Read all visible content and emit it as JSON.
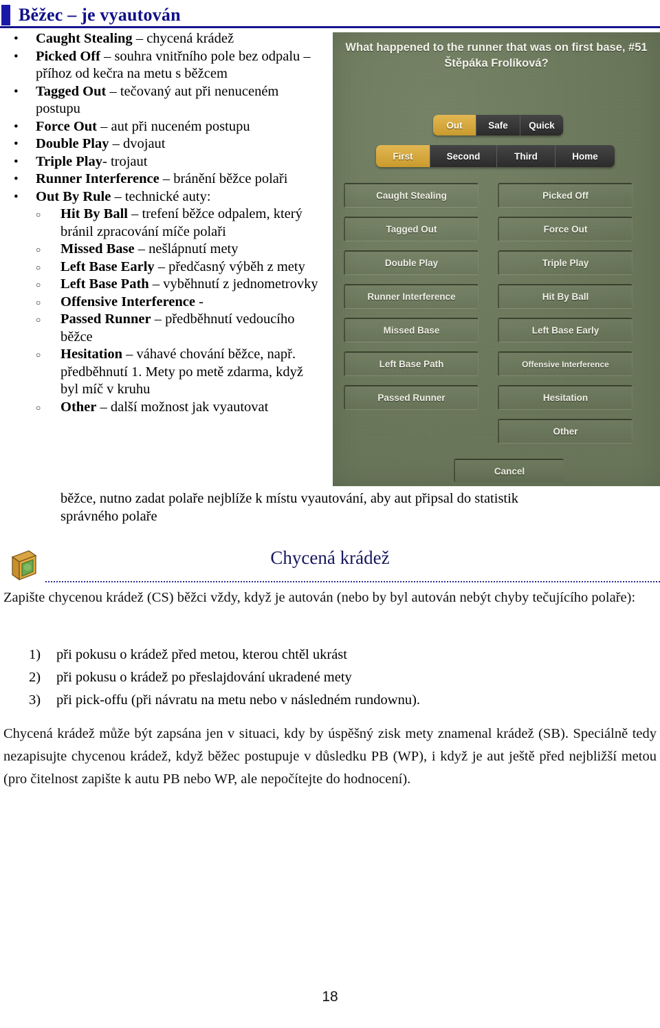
{
  "doc": {
    "title": "Běžec – je vyautován",
    "page_number": "18"
  },
  "bullets": [
    {
      "level": 1,
      "term": "Caught Stealing",
      "rest": " – chycená krádež"
    },
    {
      "level": 1,
      "term": "Picked Off",
      "rest": " – souhra vnitřního pole bez odpalu – příhoz od kečra na metu s běžcem"
    },
    {
      "level": 1,
      "term": "Tagged Out",
      "rest": " – tečovaný aut při nenuceném postupu"
    },
    {
      "level": 1,
      "term": "Force Out",
      "rest": " – aut při nuceném postupu"
    },
    {
      "level": 1,
      "term": "Double Play",
      "rest": " – dvojaut"
    },
    {
      "level": 1,
      "term": "Triple Play",
      "rest": "- trojaut"
    },
    {
      "level": 1,
      "term": "Runner Interference",
      "rest": " – bránění běžce polaři"
    },
    {
      "level": 1,
      "term": "Out By Rule",
      "rest": " – technické auty:"
    },
    {
      "level": 2,
      "term": "Hit By Ball",
      "rest": " – trefení běžce odpalem, který bránil zpracování míče polaři"
    },
    {
      "level": 2,
      "term": "Missed Base",
      "rest": " – nešlápnutí mety"
    },
    {
      "level": 2,
      "term": "Left Base Early",
      "rest": " – předčasný výběh z mety"
    },
    {
      "level": 2,
      "term": "Left Base Path",
      "rest": " – vyběhnutí z jednometrovky"
    },
    {
      "level": 2,
      "term": "Offensive Interference",
      "rest": " -"
    },
    {
      "level": 2,
      "term": "Passed Runner",
      "rest": " – předběhnutí vedoucího běžce"
    },
    {
      "level": 2,
      "term": "Hesitation",
      "rest": " – váhavé chování běžce, např. předběhnutí 1. Mety po metě zdarma, když byl míč v kruhu"
    }
  ],
  "other_item": {
    "term": "Other",
    "rest": " – další možnost jak vyautovat",
    "cont1": "běžce, nutno zadat polaře nejblíže k místu vyautování, aby aut připsal do statistik",
    "cont2": "správného polaře"
  },
  "game": {
    "question": "What happened to the runner that was on first base, #51 Štěpáka Frolíková?",
    "result_segments": [
      {
        "label": "Out",
        "selected": true
      },
      {
        "label": "Safe",
        "selected": false
      },
      {
        "label": "Quick",
        "selected": false
      }
    ],
    "base_segments": [
      {
        "label": "First",
        "selected": true
      },
      {
        "label": "Second",
        "selected": false
      },
      {
        "label": "Third",
        "selected": false
      },
      {
        "label": "Home",
        "selected": false
      }
    ],
    "options_left": [
      "Caught Stealing",
      "Tagged Out",
      "Double Play",
      "Runner Interference",
      "Missed Base",
      "Left Base Path",
      "Passed Runner"
    ],
    "options_right": [
      "Picked Off",
      "Force Out",
      "Triple Play",
      "Hit By Ball",
      "Left Base Early",
      "Offensive Interference",
      "Hesitation",
      "Other"
    ],
    "cancel_label": "Cancel",
    "colors": {
      "field_green": "#6e7c5d",
      "selected_gold": "#d9a93f",
      "segment_dark": "#343434",
      "text_light": "#f2f2ea"
    }
  },
  "section": {
    "heading": "Chycená krádež",
    "icon": "green-book-icon",
    "intro": "Zapište chycenou krádež (CS) běžci vždy, když je autován (nebo by byl autován nebýt chyby tečujícího polaře):",
    "numbered": [
      {
        "n": "1)",
        "text": "při pokusu o krádež před metou, kterou chtěl ukrást"
      },
      {
        "n": "2)",
        "text": "při pokusu o krádež po přeslajdování ukradené mety"
      },
      {
        "n": "3)",
        "text": "při pick-offu (při návratu na metu nebo v následném rundownu)."
      }
    ],
    "note": "Chycená krádež může být zapsána jen v situaci, kdy by úspěšný zisk mety znamenal krádež (SB). Speciálně tedy nezapisujte chycenou krádež, když běžec postupuje v důsledku PB (WP), i když je aut ještě před nejbližší metou (pro čitelnost zapište k autu PB nebo WP, ale nepočítejte do hodnocení)."
  },
  "colors": {
    "title_blue": "#111188",
    "rule_blue": "#14148c",
    "heading_navy": "#17175e"
  }
}
